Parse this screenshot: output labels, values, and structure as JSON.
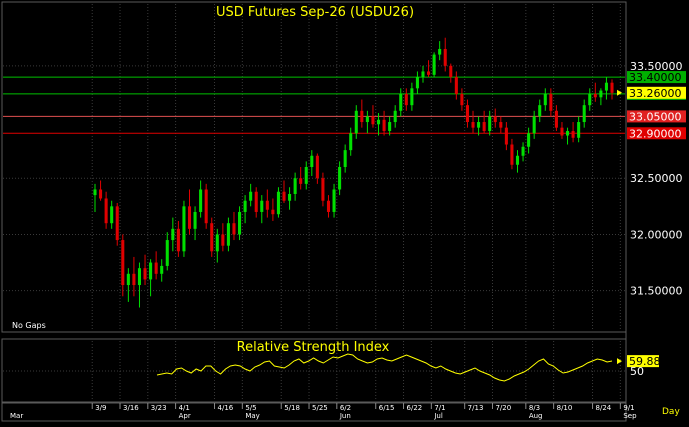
{
  "chart_data": [
    {
      "type": "candlestick",
      "title": "USD Futures Sep-26 (USDU26)",
      "note": "No Gaps",
      "ylim": [
        31.15,
        34.05
      ],
      "yticks": [
        {
          "value": 31.5,
          "label": "31.50000"
        },
        {
          "value": 32.0,
          "label": "32.00000"
        },
        {
          "value": 32.5,
          "label": "32.50000"
        },
        {
          "value": 33.5,
          "label": "33.50000"
        }
      ],
      "levels": [
        {
          "value": 33.4,
          "label": "33.40000",
          "color": "#00c000",
          "bg": "#00b000",
          "fg": "#000000"
        },
        {
          "value": 33.25,
          "label": "33.25000",
          "color": "#00c000",
          "bg": "#00b000",
          "fg": "#000000"
        },
        {
          "value": 33.05,
          "label": "33.05000",
          "color": "#e05050",
          "bg": "#e02020",
          "fg": "#ffffff"
        },
        {
          "value": 32.9,
          "label": "32.90000",
          "color": "#e00000",
          "bg": "#e00000",
          "fg": "#ffffff"
        }
      ],
      "last": {
        "value": 33.26,
        "label": "33.26000"
      },
      "colors": {
        "up": "#00e000",
        "down": "#e00000",
        "grid": "#3a3a3a",
        "axis_text": "#ffffff",
        "title": "#ffff00"
      },
      "candles": [
        [
          32.35,
          32.45,
          32.2,
          32.4
        ],
        [
          32.4,
          32.48,
          32.3,
          32.32
        ],
        [
          32.32,
          32.38,
          32.05,
          32.1
        ],
        [
          32.1,
          32.3,
          32.05,
          32.25
        ],
        [
          32.25,
          32.28,
          31.9,
          31.95
        ],
        [
          31.95,
          32.0,
          31.45,
          31.55
        ],
        [
          31.55,
          31.7,
          31.4,
          31.65
        ],
        [
          31.65,
          31.8,
          31.45,
          31.55
        ],
        [
          31.55,
          31.75,
          31.35,
          31.7
        ],
        [
          31.7,
          31.82,
          31.55,
          31.6
        ],
        [
          31.6,
          31.78,
          31.45,
          31.75
        ],
        [
          31.75,
          31.85,
          31.6,
          31.65
        ],
        [
          31.65,
          31.78,
          31.58,
          31.72
        ],
        [
          31.72,
          32.02,
          31.68,
          31.95
        ],
        [
          31.95,
          32.15,
          31.85,
          32.05
        ],
        [
          32.05,
          32.12,
          31.8,
          31.85
        ],
        [
          31.85,
          32.3,
          31.8,
          32.25
        ],
        [
          32.25,
          32.4,
          32.0,
          32.05
        ],
        [
          32.05,
          32.25,
          31.95,
          32.2
        ],
        [
          32.2,
          32.48,
          32.15,
          32.4
        ],
        [
          32.4,
          32.45,
          32.05,
          32.1
        ],
        [
          32.1,
          32.15,
          31.8,
          31.85
        ],
        [
          31.85,
          32.05,
          31.75,
          32.0
        ],
        [
          32.0,
          32.1,
          31.85,
          31.9
        ],
        [
          31.9,
          32.15,
          31.85,
          32.1
        ],
        [
          32.1,
          32.2,
          31.95,
          32.0
        ],
        [
          32.0,
          32.25,
          31.95,
          32.2
        ],
        [
          32.2,
          32.35,
          32.1,
          32.3
        ],
        [
          32.3,
          32.45,
          32.25,
          32.38
        ],
        [
          32.38,
          32.42,
          32.15,
          32.2
        ],
        [
          32.2,
          32.35,
          32.1,
          32.3
        ],
        [
          32.3,
          32.4,
          32.15,
          32.22
        ],
        [
          32.22,
          32.32,
          32.12,
          32.18
        ],
        [
          32.18,
          32.42,
          32.15,
          32.38
        ],
        [
          32.38,
          32.48,
          32.28,
          32.3
        ],
        [
          32.3,
          32.42,
          32.22,
          32.36
        ],
        [
          32.36,
          32.55,
          32.3,
          32.5
        ],
        [
          32.5,
          32.6,
          32.4,
          32.45
        ],
        [
          32.45,
          32.65,
          32.4,
          32.6
        ],
        [
          32.6,
          32.75,
          32.52,
          32.7
        ],
        [
          32.7,
          32.72,
          32.45,
          32.5
        ],
        [
          32.5,
          32.55,
          32.25,
          32.3
        ],
        [
          32.3,
          32.35,
          32.15,
          32.2
        ],
        [
          32.2,
          32.45,
          32.15,
          32.4
        ],
        [
          32.4,
          32.65,
          32.35,
          32.6
        ],
        [
          32.6,
          32.8,
          32.55,
          32.75
        ],
        [
          32.75,
          32.95,
          32.7,
          32.9
        ],
        [
          32.9,
          33.15,
          32.85,
          33.1
        ],
        [
          33.1,
          33.2,
          32.95,
          33.0
        ],
        [
          33.0,
          33.1,
          32.9,
          33.05
        ],
        [
          33.05,
          33.15,
          32.95,
          32.98
        ],
        [
          32.98,
          33.08,
          32.88,
          33.02
        ],
        [
          33.02,
          33.1,
          32.88,
          32.92
        ],
        [
          32.92,
          33.05,
          32.88,
          33.0
        ],
        [
          33.0,
          33.15,
          32.95,
          33.1
        ],
        [
          33.1,
          33.3,
          33.05,
          33.25
        ],
        [
          33.25,
          33.3,
          33.1,
          33.15
        ],
        [
          33.15,
          33.35,
          33.1,
          33.3
        ],
        [
          33.3,
          33.45,
          33.25,
          33.4
        ],
        [
          33.4,
          33.5,
          33.35,
          33.45
        ],
        [
          33.45,
          33.55,
          33.4,
          33.42
        ],
        [
          33.42,
          33.62,
          33.4,
          33.6
        ],
        [
          33.6,
          33.72,
          33.55,
          33.65
        ],
        [
          33.65,
          33.75,
          33.45,
          33.5
        ],
        [
          33.5,
          33.52,
          33.35,
          33.4
        ],
        [
          33.4,
          33.45,
          33.2,
          33.25
        ],
        [
          33.25,
          33.3,
          33.1,
          33.15
        ],
        [
          33.15,
          33.2,
          32.95,
          33.0
        ],
        [
          33.0,
          33.1,
          32.9,
          32.95
        ],
        [
          32.95,
          33.05,
          32.88,
          33.0
        ],
        [
          33.0,
          33.1,
          32.9,
          32.92
        ],
        [
          32.92,
          33.1,
          32.88,
          33.05
        ],
        [
          33.05,
          33.12,
          32.95,
          33.0
        ],
        [
          33.0,
          33.05,
          32.9,
          32.95
        ],
        [
          32.95,
          33.0,
          32.75,
          32.8
        ],
        [
          32.8,
          32.85,
          32.58,
          32.62
        ],
        [
          32.62,
          32.75,
          32.55,
          32.7
        ],
        [
          32.7,
          32.82,
          32.65,
          32.78
        ],
        [
          32.78,
          32.95,
          32.72,
          32.9
        ],
        [
          32.9,
          33.1,
          32.85,
          33.05
        ],
        [
          33.05,
          33.2,
          33.0,
          33.15
        ],
        [
          33.15,
          33.3,
          33.1,
          33.25
        ],
        [
          33.25,
          33.3,
          33.05,
          33.1
        ],
        [
          33.1,
          33.15,
          32.92,
          32.95
        ],
        [
          32.95,
          33.0,
          32.85,
          32.88
        ],
        [
          32.88,
          32.95,
          32.8,
          32.92
        ],
        [
          32.92,
          33.0,
          32.82,
          32.86
        ],
        [
          32.86,
          33.05,
          32.82,
          33.0
        ],
        [
          33.0,
          33.2,
          32.95,
          33.15
        ],
        [
          33.15,
          33.3,
          33.1,
          33.25
        ],
        [
          33.25,
          33.35,
          33.18,
          33.22
        ],
        [
          33.22,
          33.3,
          33.15,
          33.28
        ],
        [
          33.28,
          33.4,
          33.2,
          33.35
        ],
        [
          33.35,
          33.38,
          33.2,
          33.26
        ]
      ],
      "xticks": [
        {
          "i": 0,
          "label": "3/9"
        },
        {
          "i": 5,
          "label": "3/16"
        },
        {
          "i": 10,
          "label": "3/23"
        },
        {
          "i": 15,
          "label": "4/1"
        },
        {
          "i": 22,
          "label": "4/16"
        },
        {
          "i": 27,
          "label": "5/5"
        },
        {
          "i": 34,
          "label": "5/18"
        },
        {
          "i": 39,
          "label": "5/25"
        },
        {
          "i": 44,
          "label": "6/2"
        },
        {
          "i": 51,
          "label": "6/15"
        },
        {
          "i": 56,
          "label": "6/22"
        },
        {
          "i": 61,
          "label": "7/1"
        },
        {
          "i": 67,
          "label": "7/13"
        },
        {
          "i": 72,
          "label": "7/20"
        },
        {
          "i": 78,
          "label": "8/3"
        },
        {
          "i": 83,
          "label": "8/10"
        },
        {
          "i": 90,
          "label": "8/24"
        },
        {
          "i": 95,
          "label": "9/1"
        }
      ],
      "month_labels": [
        {
          "i": 0,
          "label": "Mar"
        },
        {
          "i": 15,
          "label": "Apr"
        },
        {
          "i": 27,
          "label": "May"
        },
        {
          "i": 44,
          "label": "Jun"
        },
        {
          "i": 61,
          "label": "Jul"
        },
        {
          "i": 78,
          "label": "Aug"
        },
        {
          "i": 95,
          "label": "Sep"
        }
      ],
      "xunit": "Day"
    },
    {
      "type": "line",
      "title": "Relative Strength Index",
      "ylim": [
        20,
        80
      ],
      "yticks": [
        {
          "value": 50,
          "label": "50"
        }
      ],
      "last": {
        "value": 59.88,
        "label": "59.88"
      },
      "color": "#ffff00",
      "values": [
        46,
        47,
        48,
        47,
        52,
        53,
        50,
        48,
        52,
        50,
        55,
        55,
        50,
        47,
        52,
        55,
        56,
        55,
        52,
        50,
        54,
        56,
        59,
        60,
        55,
        54,
        53,
        56,
        60,
        62,
        58,
        60,
        63,
        60,
        58,
        61,
        64,
        63,
        65,
        67,
        66,
        62,
        60,
        58,
        59,
        62,
        63,
        61,
        60,
        62,
        64,
        66,
        64,
        62,
        60,
        58,
        55,
        53,
        55,
        52,
        50,
        48,
        47,
        49,
        51,
        53,
        50,
        48,
        46,
        43,
        41,
        40,
        42,
        45,
        47,
        49,
        52,
        56,
        60,
        62,
        57,
        55,
        51,
        48,
        49,
        51,
        53,
        55,
        58,
        60,
        62,
        61,
        59,
        60
      ]
    }
  ]
}
